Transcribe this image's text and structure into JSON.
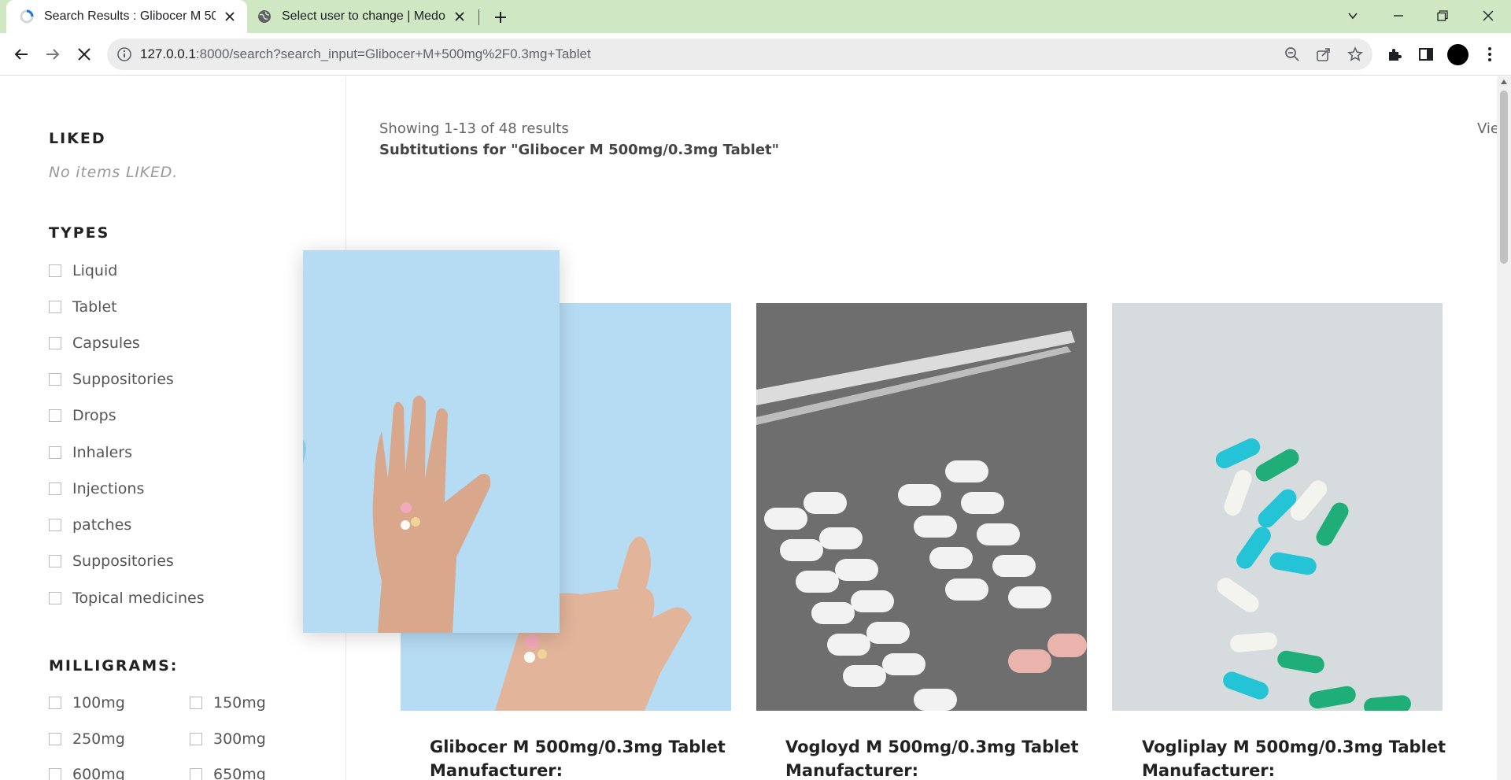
{
  "browser": {
    "tabs": [
      {
        "title": "Search Results : Glibocer M 500mg/0.3mg Tablet",
        "active": true
      },
      {
        "title": "Select user to change | Medopt Admin",
        "active": false
      }
    ],
    "url_host": "127.0.0.1",
    "url_rest": ":8000/search?search_input=Glibocer+M+500mg%2F0.3mg+Tablet"
  },
  "sidebar": {
    "liked_title": "LIKED",
    "liked_empty": "No items LIKED.",
    "types_title": "TYPES",
    "types": [
      "Liquid",
      "Tablet",
      "Capsules",
      "Suppositories",
      "Drops",
      "Inhalers",
      "Injections",
      "patches",
      "Suppositories",
      "Topical medicines"
    ],
    "mg_title": "MILLIGRAMS:",
    "milligrams": [
      "100mg",
      "150mg",
      "250mg",
      "300mg",
      "600mg",
      "650mg"
    ]
  },
  "results": {
    "showing": "Showing 1-13 of 48 results",
    "subtitle": "Subtitutions for \"Glibocer M 500mg/0.3mg Tablet\"",
    "view_label": "Vie"
  },
  "products": [
    {
      "name": "Glibocer M 500mg/0.3mg Tablet",
      "manufacturer_label": "Manufacturer:"
    },
    {
      "name": "Vogloyd M 500mg/0.3mg Tablet",
      "manufacturer_label": "Manufacturer:"
    },
    {
      "name": "Vogliplay M 500mg/0.3mg Tablet",
      "manufacturer_label": "Manufacturer:"
    }
  ],
  "colors": {
    "tab_strip": "#cfe8c3",
    "photo_blue": "#b6dcf4",
    "photo_grey": "#6e6e6e",
    "photo_light": "#d6dcdd"
  }
}
